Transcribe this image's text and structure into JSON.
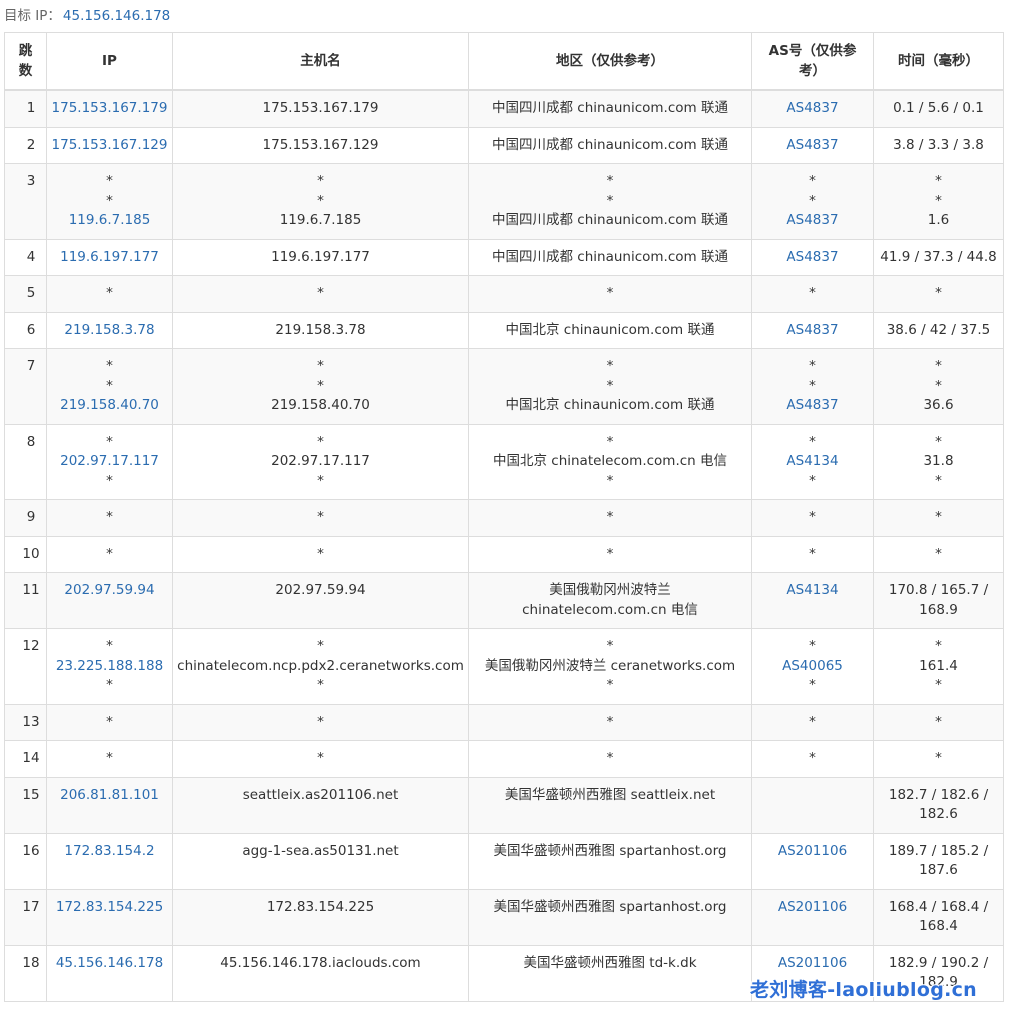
{
  "target": {
    "label": "目标 IP：",
    "ip": "45.156.146.178"
  },
  "headers": {
    "hop": "跳数",
    "ip": "IP",
    "host": "主机名",
    "region": "地区（仅供参考）",
    "as": "AS号（仅供参考）",
    "time": "时间（毫秒）"
  },
  "rows": [
    {
      "hop": "1",
      "ip": [
        "175.153.167.179"
      ],
      "host": [
        "175.153.167.179"
      ],
      "region": [
        "中国四川成都 chinaunicom.com 联通"
      ],
      "as": [
        "AS4837"
      ],
      "time": [
        "0.1 / 5.6 / 0.1"
      ]
    },
    {
      "hop": "2",
      "ip": [
        "175.153.167.129"
      ],
      "host": [
        "175.153.167.129"
      ],
      "region": [
        "中国四川成都 chinaunicom.com 联通"
      ],
      "as": [
        "AS4837"
      ],
      "time": [
        "3.8 / 3.3 / 3.8"
      ]
    },
    {
      "hop": "3",
      "ip": [
        "*",
        "*",
        "119.6.7.185"
      ],
      "host": [
        "*",
        "*",
        "119.6.7.185"
      ],
      "region": [
        "*",
        "*",
        "中国四川成都 chinaunicom.com 联通"
      ],
      "as": [
        "*",
        "*",
        "AS4837"
      ],
      "time": [
        "*",
        "*",
        "1.6"
      ]
    },
    {
      "hop": "4",
      "ip": [
        "119.6.197.177"
      ],
      "host": [
        "119.6.197.177"
      ],
      "region": [
        "中国四川成都 chinaunicom.com 联通"
      ],
      "as": [
        "AS4837"
      ],
      "time": [
        "41.9 / 37.3 / 44.8"
      ]
    },
    {
      "hop": "5",
      "ip": [
        "*"
      ],
      "host": [
        "*"
      ],
      "region": [
        "*"
      ],
      "as": [
        "*"
      ],
      "time": [
        "*"
      ]
    },
    {
      "hop": "6",
      "ip": [
        "219.158.3.78"
      ],
      "host": [
        "219.158.3.78"
      ],
      "region": [
        "中国北京 chinaunicom.com 联通"
      ],
      "as": [
        "AS4837"
      ],
      "time": [
        "38.6 / 42 / 37.5"
      ]
    },
    {
      "hop": "7",
      "ip": [
        "*",
        "*",
        "219.158.40.70"
      ],
      "host": [
        "*",
        "*",
        "219.158.40.70"
      ],
      "region": [
        "*",
        "*",
        "中国北京 chinaunicom.com 联通"
      ],
      "as": [
        "*",
        "*",
        "AS4837"
      ],
      "time": [
        "*",
        "*",
        "36.6"
      ]
    },
    {
      "hop": "8",
      "ip": [
        "*",
        "202.97.17.117",
        "*"
      ],
      "host": [
        "*",
        "202.97.17.117",
        "*"
      ],
      "region": [
        "*",
        "中国北京 chinatelecom.com.cn 电信",
        "*"
      ],
      "as": [
        "*",
        "AS4134",
        "*"
      ],
      "time": [
        "*",
        "31.8",
        "*"
      ]
    },
    {
      "hop": "9",
      "ip": [
        "*"
      ],
      "host": [
        "*"
      ],
      "region": [
        "*"
      ],
      "as": [
        "*"
      ],
      "time": [
        "*"
      ]
    },
    {
      "hop": "10",
      "ip": [
        "*"
      ],
      "host": [
        "*"
      ],
      "region": [
        "*"
      ],
      "as": [
        "*"
      ],
      "time": [
        "*"
      ]
    },
    {
      "hop": "11",
      "ip": [
        "202.97.59.94"
      ],
      "host": [
        "202.97.59.94"
      ],
      "region": [
        "美国俄勒冈州波特兰",
        "chinatelecom.com.cn 电信"
      ],
      "as": [
        "AS4134"
      ],
      "time": [
        "170.8 / 165.7 /",
        "168.9"
      ]
    },
    {
      "hop": "12",
      "ip": [
        "*",
        "23.225.188.188",
        "*"
      ],
      "host": [
        "*",
        "chinatelecom.ncp.pdx2.ceranetworks.com",
        "*"
      ],
      "region": [
        "*",
        "美国俄勒冈州波特兰 ceranetworks.com",
        "*"
      ],
      "as": [
        "*",
        "AS40065",
        "*"
      ],
      "time": [
        "*",
        "161.4",
        "*"
      ]
    },
    {
      "hop": "13",
      "ip": [
        "*"
      ],
      "host": [
        "*"
      ],
      "region": [
        "*"
      ],
      "as": [
        "*"
      ],
      "time": [
        "*"
      ]
    },
    {
      "hop": "14",
      "ip": [
        "*"
      ],
      "host": [
        "*"
      ],
      "region": [
        "*"
      ],
      "as": [
        "*"
      ],
      "time": [
        "*"
      ]
    },
    {
      "hop": "15",
      "ip": [
        "206.81.81.101"
      ],
      "host": [
        "seattleix.as201106.net"
      ],
      "region": [
        "美国华盛顿州西雅图 seattleix.net"
      ],
      "as": [],
      "time": [
        "182.7 / 182.6 /",
        "182.6"
      ]
    },
    {
      "hop": "16",
      "ip": [
        "172.83.154.2"
      ],
      "host": [
        "agg-1-sea.as50131.net"
      ],
      "region": [
        "美国华盛顿州西雅图 spartanhost.org"
      ],
      "as": [
        "AS201106"
      ],
      "time": [
        "189.7 / 185.2 /",
        "187.6"
      ]
    },
    {
      "hop": "17",
      "ip": [
        "172.83.154.225"
      ],
      "host": [
        "172.83.154.225"
      ],
      "region": [
        "美国华盛顿州西雅图 spartanhost.org"
      ],
      "as": [
        "AS201106"
      ],
      "time": [
        "168.4 / 168.4 /",
        "168.4"
      ]
    },
    {
      "hop": "18",
      "ip": [
        "45.156.146.178"
      ],
      "host": [
        "45.156.146.178.iaclouds.com"
      ],
      "region": [
        "美国华盛顿州西雅图 td-k.dk"
      ],
      "as": [
        "AS201106"
      ],
      "time": [
        "182.9 / 190.2 /",
        "182.9"
      ]
    }
  ],
  "watermark": "老刘博客-laoliublog.cn",
  "colors": {
    "link": "#2b6cb0",
    "border": "#dddddd",
    "stripe": "#f9f9f9",
    "watermark": "#2f6fd6"
  }
}
